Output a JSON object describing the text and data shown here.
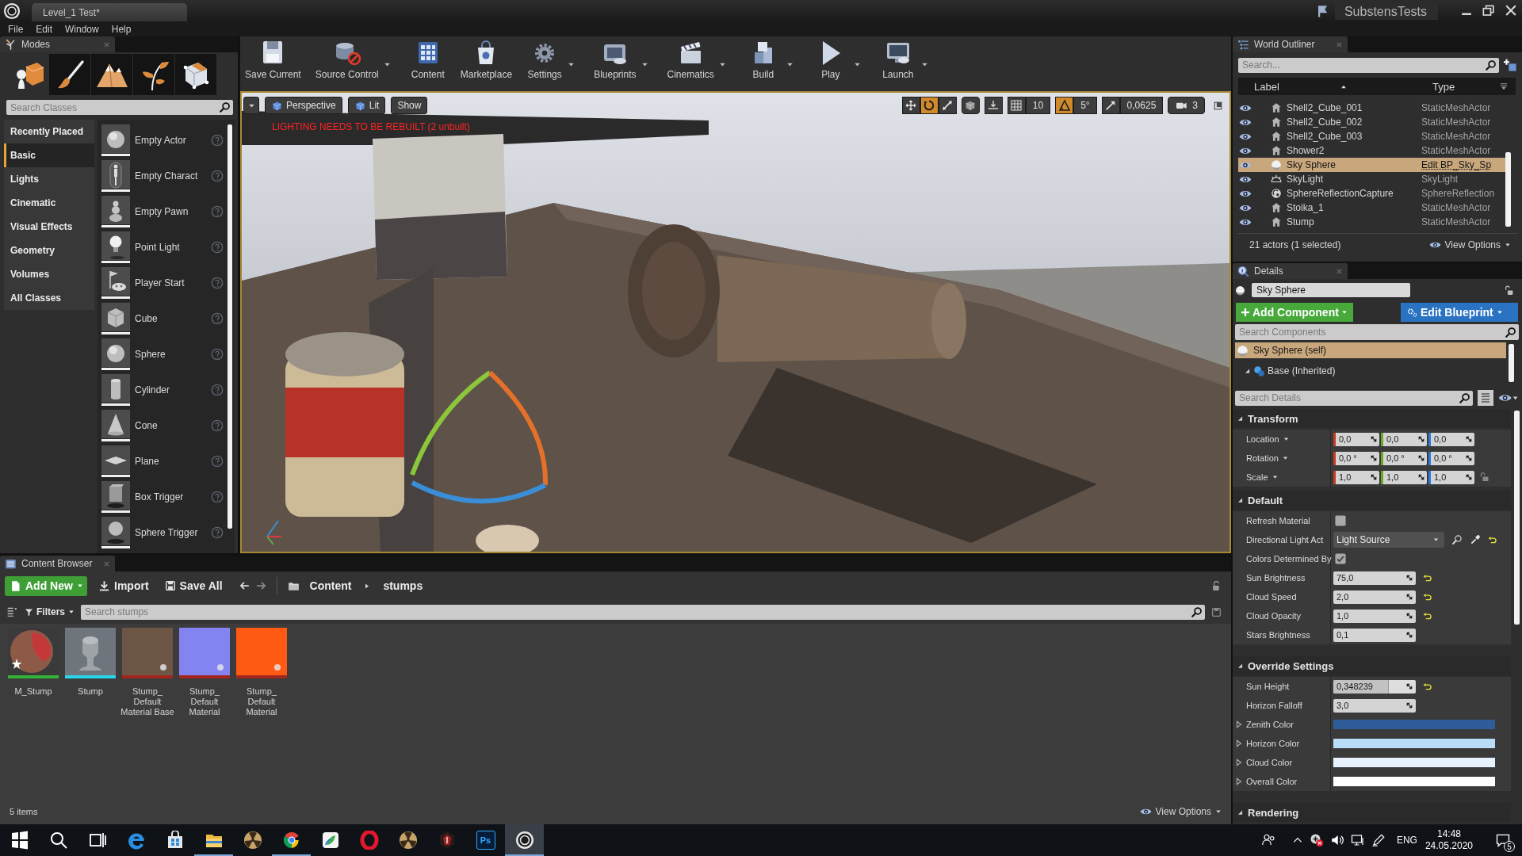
{
  "title_bar": {
    "document_tab": "Level_1 Test*",
    "project": "SubstensTests"
  },
  "menu": [
    "File",
    "Edit",
    "Window",
    "Help"
  ],
  "modes_panel": {
    "tab": "Modes",
    "modes": [
      {
        "kind": "place",
        "selected": true
      },
      {
        "kind": "paint",
        "selected": false
      },
      {
        "kind": "landscape",
        "selected": false
      },
      {
        "kind": "foliage",
        "selected": false
      },
      {
        "kind": "geometry",
        "selected": false
      }
    ],
    "search": {
      "placeholder": "Search Classes"
    },
    "categories": [
      {
        "label": "Recently Placed",
        "selected": false
      },
      {
        "label": "Basic",
        "selected": true
      },
      {
        "label": "Lights",
        "selected": false
      },
      {
        "label": "Cinematic",
        "selected": false
      },
      {
        "label": "Visual Effects",
        "selected": false
      },
      {
        "label": "Geometry",
        "selected": false
      },
      {
        "label": "Volumes",
        "selected": false
      },
      {
        "label": "All Classes",
        "selected": false
      }
    ],
    "items": [
      {
        "label": "Empty Actor",
        "kind": "sphere"
      },
      {
        "label": "Empty Charact",
        "kind": "character"
      },
      {
        "label": "Empty Pawn",
        "kind": "pawn"
      },
      {
        "label": "Point Light",
        "kind": "bulb"
      },
      {
        "label": "Player Start",
        "kind": "player_start"
      },
      {
        "label": "Cube",
        "kind": "cube"
      },
      {
        "label": "Sphere",
        "kind": "sphere"
      },
      {
        "label": "Cylinder",
        "kind": "cylinder"
      },
      {
        "label": "Cone",
        "kind": "cone"
      },
      {
        "label": "Plane",
        "kind": "plane"
      },
      {
        "label": "Box Trigger",
        "kind": "box_trigger"
      },
      {
        "label": "Sphere Trigger",
        "kind": "sphere_trigger"
      }
    ]
  },
  "toolbar": [
    {
      "label": "Save Current",
      "kind": "save",
      "dropdown": false
    },
    {
      "label": "Source Control",
      "kind": "source_control",
      "dropdown": true
    },
    {
      "label": "Content",
      "kind": "content",
      "dropdown": false
    },
    {
      "label": "Marketplace",
      "kind": "marketplace",
      "dropdown": false
    },
    {
      "label": "Settings",
      "kind": "settings",
      "dropdown": true
    },
    {
      "label": "Blueprints",
      "kind": "blueprints",
      "dropdown": true
    },
    {
      "label": "Cinematics",
      "kind": "cinematics",
      "dropdown": true
    },
    {
      "label": "Build",
      "kind": "build",
      "dropdown": true
    },
    {
      "label": "Play",
      "kind": "play",
      "dropdown": true
    },
    {
      "label": "Launch",
      "kind": "launch",
      "dropdown": true
    }
  ],
  "viewport": {
    "view_buttons": [
      {
        "kind": "menu"
      },
      {
        "kind": "perspective",
        "label": "Perspective"
      },
      {
        "kind": "lit",
        "label": "Lit"
      },
      {
        "kind": "show",
        "label": "Show"
      }
    ],
    "warning": "LIGHTING NEEDS TO BE REBUILT (2 unbuilt)",
    "transform_tools": [
      {
        "kind": "translate",
        "selected": false
      },
      {
        "kind": "rotate",
        "selected": true
      },
      {
        "kind": "scale",
        "selected": false
      }
    ],
    "snaps": [
      {
        "kind": "grid",
        "value": "10",
        "on": false
      },
      {
        "kind": "angle",
        "value": "5°",
        "on": true
      },
      {
        "kind": "scale",
        "value": "0,0625",
        "on": false
      }
    ],
    "camera_speed": "3"
  },
  "outliner": {
    "tab": "World Outliner",
    "search": {
      "placeholder": "Search..."
    },
    "columns": [
      "Label",
      "Type"
    ],
    "rows": [
      {
        "label": "Shell2_Cube_001",
        "type": "StaticMeshActor",
        "kind": "mesh",
        "visible": true,
        "selected": false
      },
      {
        "label": "Shell2_Cube_002",
        "type": "StaticMeshActor",
        "kind": "mesh",
        "visible": true,
        "selected": false
      },
      {
        "label": "Shell2_Cube_003",
        "type": "StaticMeshActor",
        "kind": "mesh",
        "visible": true,
        "selected": false
      },
      {
        "label": "Shower2",
        "type": "StaticMeshActor",
        "kind": "mesh",
        "visible": true,
        "selected": false
      },
      {
        "label": "Sky Sphere",
        "type": "Edit BP_Sky_Sp",
        "kind": "blueprint",
        "visible": true,
        "selected": true
      },
      {
        "label": "SkyLight",
        "type": "SkyLight",
        "kind": "sky_light",
        "visible": true,
        "selected": false
      },
      {
        "label": "SphereReflectionCapture",
        "type": "SphereReflection",
        "kind": "reflection",
        "visible": true,
        "selected": false
      },
      {
        "label": "Stoika_1",
        "type": "StaticMeshActor",
        "kind": "mesh",
        "visible": true,
        "selected": false
      },
      {
        "label": "Stump",
        "type": "StaticMeshActor",
        "kind": "mesh",
        "visible": true,
        "selected": false
      }
    ],
    "summary": "21 actors (1 selected)",
    "view_options": "View Options"
  },
  "details": {
    "tab": "Details",
    "actor_name": "Sky Sphere",
    "add_component": "Add Component",
    "edit_blueprint": "Edit Blueprint",
    "component_search": {
      "placeholder": "Search Components"
    },
    "components": [
      {
        "label": "Sky Sphere (self)",
        "selected": true,
        "children": [
          {
            "label": "Base (Inherited)",
            "selected": false,
            "expanded": true
          }
        ]
      }
    ],
    "details_search": {
      "placeholder": "Search Details"
    },
    "sections": [
      {
        "title": "Transform",
        "expanded": true,
        "rows": [
          {
            "kind": "vector",
            "label": "Location",
            "values": [
              "0,0",
              "0,0",
              "0,0"
            ]
          },
          {
            "kind": "vector",
            "label": "Rotation",
            "values": [
              "0,0 °",
              "0,0 °",
              "0,0 °"
            ]
          },
          {
            "kind": "vector",
            "label": "Scale",
            "values": [
              "1,0",
              "1,0",
              "1,0"
            ],
            "locked": false
          }
        ]
      },
      {
        "title": "Default",
        "expanded": true,
        "rows": [
          {
            "kind": "checkbox",
            "label": "Refresh Material",
            "checked": false,
            "modified": false
          },
          {
            "kind": "actor",
            "label": "Directional Light Act",
            "value": "Light Source",
            "modified": true
          },
          {
            "kind": "checkbox",
            "label": "Colors Determined By",
            "checked": true,
            "modified": false
          },
          {
            "kind": "number",
            "label": "Sun Brightness",
            "value": "75,0",
            "modified": true
          },
          {
            "kind": "number",
            "label": "Cloud Speed",
            "value": "2,0",
            "modified": true
          },
          {
            "kind": "number",
            "label": "Cloud Opacity",
            "value": "1,0",
            "modified": true
          },
          {
            "kind": "number",
            "label": "Stars Brightness",
            "value": "0,1",
            "modified": false
          }
        ]
      },
      {
        "title": "Override Settings",
        "expanded": true,
        "rows": [
          {
            "kind": "slider",
            "label": "Sun Height",
            "value": "0,348239",
            "level": 0.67,
            "modified": true
          },
          {
            "kind": "number",
            "label": "Horizon Falloff",
            "value": "3,0",
            "modified": false
          },
          {
            "kind": "color",
            "label": "Zenith Color",
            "color": "#2f5d9a",
            "expanded": false
          },
          {
            "kind": "color",
            "label": "Horizon Color",
            "color": "#b9dcf7",
            "expanded": false
          },
          {
            "kind": "color",
            "label": "Cloud Color",
            "color": "#e8f2fc",
            "expanded": false
          },
          {
            "kind": "color",
            "label": "Overall Color",
            "color": "#ffffff",
            "expanded": false
          }
        ]
      },
      {
        "title": "Rendering",
        "expanded": true
      }
    ]
  },
  "content_browser": {
    "tab": "Content Browser",
    "add_new": "Add New",
    "import": "Import",
    "save_all": "Save All",
    "path": [
      "Content",
      "stumps"
    ],
    "filters": "Filters",
    "search": {
      "placeholder": "Search stumps"
    },
    "assets": [
      {
        "label": "M_Stump",
        "kind": "material",
        "color": "#8e5a48"
      },
      {
        "label": "Stump",
        "kind": "mesh",
        "color": "#6f757c"
      },
      {
        "label": "Stump_ Default Material Base",
        "kind": "texture",
        "color": "#6e5646"
      },
      {
        "label": "Stump_ Default Material",
        "kind": "texture",
        "color": "#8383f2"
      },
      {
        "label": "Stump_ Default Material",
        "kind": "texture",
        "color": "#ff5a14"
      }
    ],
    "count": "5 items",
    "view_options": "View Options"
  },
  "taskbar": {
    "apps": [
      {
        "kind": "start",
        "selected": false,
        "running": false
      },
      {
        "kind": "search",
        "selected": false,
        "running": false
      },
      {
        "kind": "task_view",
        "selected": false,
        "running": false
      },
      {
        "kind": "swirl",
        "selected": false,
        "running": false
      },
      {
        "kind": "bag",
        "selected": false,
        "running": false
      },
      {
        "kind": "folder",
        "selected": false,
        "running": true
      },
      {
        "kind": "trefoil",
        "selected": false,
        "running": false
      },
      {
        "kind": "tricolor",
        "selected": false,
        "running": true
      },
      {
        "kind": "leaf_tile",
        "selected": false,
        "running": false
      },
      {
        "kind": "ring",
        "selected": false,
        "running": false
      },
      {
        "kind": "trefoil",
        "selected": false,
        "running": false
      },
      {
        "kind": "emblem",
        "selected": false,
        "running": false
      },
      {
        "kind": "text_tile",
        "label": "Ps",
        "selected": false,
        "running": false
      },
      {
        "kind": "logo",
        "selected": true,
        "running": true
      }
    ],
    "tray": {
      "language": "ENG",
      "time": "14:48",
      "date": "24.05.2020",
      "notifications": "5"
    }
  }
}
